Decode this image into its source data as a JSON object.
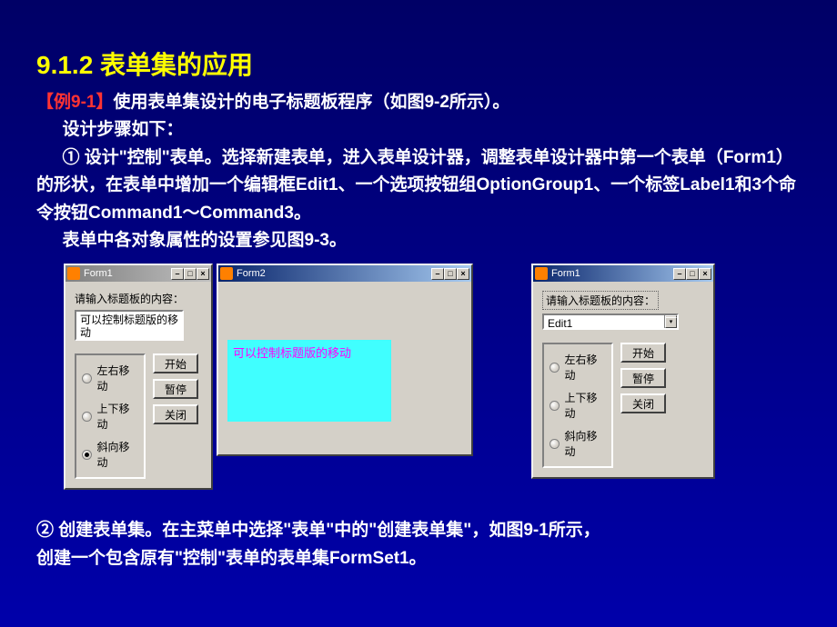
{
  "heading": "9.1.2  表单集的应用",
  "line1_prefix": "【例9-1】",
  "line1_rest": "使用表单集设计的电子标题板程序（如图9-2所示）。",
  "line2": "设计步骤如下：",
  "para1_a": "① 设计\"控制\"表单。选择新建表单，进入表单设计器，调整表单设计器中第一个表单（",
  "para1_form": "Form1",
  "para1_b": "）的形状，在表单中增加一个编辑框",
  "para1_edit": "Edit1",
  "para1_c": "、一个选项按钮组",
  "para1_opt": "OptionGroup1",
  "para1_d": "、一个标签",
  "para1_label": "Label1",
  "para1_e": "和3个命令按钮",
  "para1_cmd1": "Command1",
  "para1_tilde": "～",
  "para1_cmd3": "Command3",
  "para1_end": "。",
  "line_settings": "表单中各对象属性的设置参见图9-3。",
  "form1": {
    "title": "Form1",
    "prompt": "请输入标题板的内容：",
    "editValue": "可以控制标题版的移动",
    "options": [
      "左右移动",
      "上下移动",
      "斜向移动"
    ],
    "selectedIndex": 2,
    "buttons": [
      "开始",
      "暂停",
      "关闭"
    ]
  },
  "form2": {
    "title": "Form2",
    "scrollText": "可以控制标题版的移动"
  },
  "form3": {
    "title": "Form1",
    "prompt": "请输入标题板的内容：",
    "editValue": "Edit1",
    "options": [
      "左右移动",
      "上下移动",
      "斜向移动"
    ],
    "selectedIndex": -1,
    "buttons": [
      "开始",
      "暂停",
      "关闭"
    ]
  },
  "footer_a": "② 创建表单集。在主菜单中选择\"表单\"中的\"创建表单集\"，如图9-1所示，",
  "footer_b": "创建一个包含原有\"控制\"表单的表单集",
  "footer_formset": "FormSet1",
  "footer_end": "。",
  "titlebar_icons": {
    "min": "–",
    "max": "□",
    "close": "×"
  }
}
